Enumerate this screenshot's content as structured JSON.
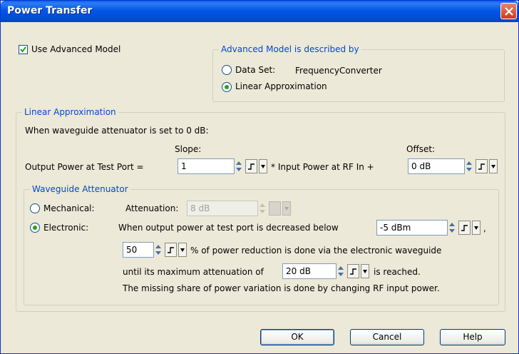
{
  "window": {
    "title": "Power Transfer"
  },
  "use_advanced_model": {
    "label": "Use Advanced Model",
    "checked": true
  },
  "advanced_group": {
    "legend": "Advanced Model is described by",
    "data_set": {
      "label": "Data Set:",
      "value": "FrequencyConverter",
      "selected": false
    },
    "linear": {
      "label": "Linear Approximation",
      "selected": true
    }
  },
  "linear_group": {
    "legend": "Linear Approximation",
    "intro": "When waveguide attenuator is set to 0 dB:",
    "slope_label": "Slope:",
    "offset_label": "Offset:",
    "output_label": "Output Power at Test Port  =",
    "slope_value": "1",
    "multiply_text": "* Input Power at RF In +",
    "offset_value": "0 dB"
  },
  "waveguide_group": {
    "legend": "Waveguide Attenuator",
    "mechanical": {
      "label": "Mechanical:",
      "selected": false
    },
    "attenuation_label": "Attenuation:",
    "attenuation_value": "8 dB",
    "electronic": {
      "label": "Electronic:",
      "selected": true
    },
    "decrease_text": "When output power at test port is decreased below",
    "threshold_value": "-5 dBm",
    "comma": ",",
    "percent_value": "50",
    "percent_text": "% of power reduction is done via the electronic waveguide",
    "until_text": "until its maximum attenuation of",
    "max_atten_value": "20 dB",
    "reached_text": "is reached.",
    "missing_text": "The missing share of power variation is done by changing RF input power."
  },
  "buttons": {
    "ok": "OK",
    "cancel": "Cancel",
    "help": "Help"
  },
  "colors": {
    "title_bar": "#0058e6",
    "group_legend": "#0046d5",
    "dialog_bg": "#ece9d8",
    "radio_dot": "#21a121"
  },
  "icons": [
    "close-icon",
    "check-icon",
    "step-icon",
    "spin-arrows-icon",
    "dropdown-arrow-icon"
  ]
}
